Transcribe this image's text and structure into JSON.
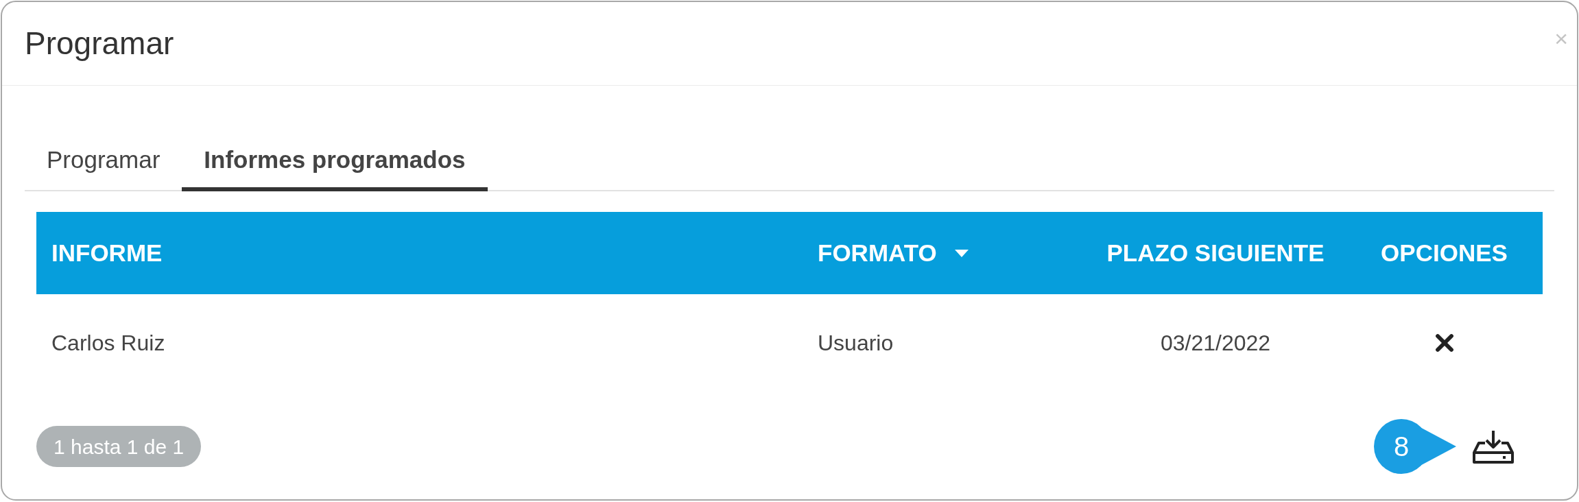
{
  "dialog": {
    "title": "Programar",
    "close": "×"
  },
  "tabs": [
    {
      "label": "Programar",
      "selected": false
    },
    {
      "label": "Informes programados",
      "selected": true
    }
  ],
  "table": {
    "columns": [
      {
        "label": "INFORME",
        "sortable": false
      },
      {
        "label": "FORMATO",
        "sortable": true
      },
      {
        "label": "PLAZO SIGUIENTE",
        "sortable": false
      },
      {
        "label": "OPCIONES",
        "sortable": false
      }
    ],
    "rows": [
      {
        "cells": [
          "Carlos Ruiz",
          "Usuario",
          "03/21/2022"
        ]
      }
    ]
  },
  "pagination": "1 hasta 1 de 1",
  "callout": "8"
}
